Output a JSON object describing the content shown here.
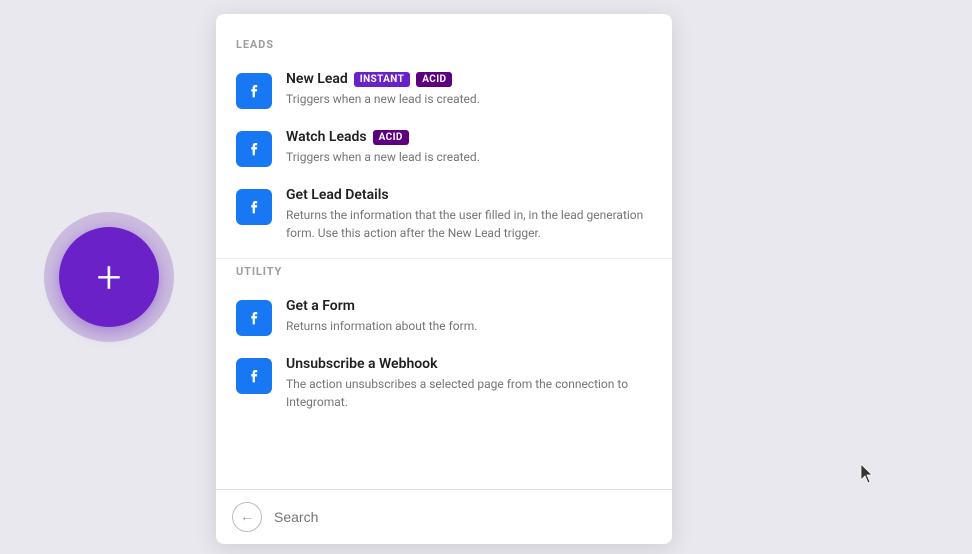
{
  "background_color": "#e8e8ee",
  "add_button": {
    "label": "+"
  },
  "sections": [
    {
      "label": "LEADS",
      "items": [
        {
          "title": "New Lead",
          "badges": [
            "INSTANT",
            "ACID"
          ],
          "description": "Triggers when a new lead is created."
        },
        {
          "title": "Watch Leads",
          "badges": [
            "ACID"
          ],
          "description": "Triggers when a new lead is created."
        },
        {
          "title": "Get Lead Details",
          "badges": [],
          "description": "Returns the information that the user filled in, in the lead generation form. Use this action after the New Lead trigger."
        }
      ]
    },
    {
      "label": "UTILITY",
      "items": [
        {
          "title": "Get a Form",
          "badges": [],
          "description": "Returns information about the form."
        },
        {
          "title": "Unsubscribe a Webhook",
          "badges": [],
          "description": "The action unsubscribes a selected page from the connection to Integromat."
        }
      ]
    }
  ],
  "search": {
    "placeholder": "Search"
  }
}
